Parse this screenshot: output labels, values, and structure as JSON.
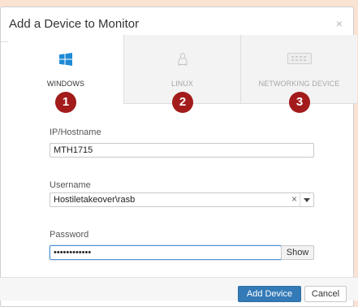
{
  "dialog": {
    "title": "Add a Device to Monitor",
    "close_glyph": "×"
  },
  "tabs": [
    {
      "label": "WINDOWS",
      "icon": "windows-icon",
      "badge": "1",
      "active": true
    },
    {
      "label": "LINUX",
      "icon": "linux-icon",
      "badge": "2",
      "active": false
    },
    {
      "label": "NETWORKING DEVICE",
      "icon": "network-device-icon",
      "badge": "3",
      "active": false
    }
  ],
  "fields": {
    "host": {
      "label": "IP/Hostname",
      "value": "MTH1715"
    },
    "username": {
      "label": "Username",
      "value": "Hostiletakeover\\rasb",
      "clear_glyph": "×"
    },
    "password": {
      "label": "Password",
      "value": "••••••••••••",
      "show_label": "Show"
    }
  },
  "footer": {
    "add_label": "Add Device",
    "cancel_label": "Cancel"
  },
  "colors": {
    "badge": "#a31b1b",
    "primary": "#337ab7",
    "background": "#fbe3d4"
  }
}
